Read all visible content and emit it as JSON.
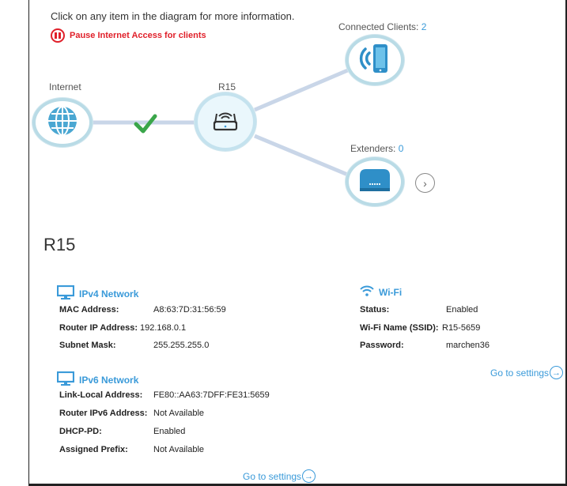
{
  "diagram": {
    "instruction": "Click on any item in the diagram for more information.",
    "pause_label": "Pause Internet Access for clients",
    "internet_label": "Internet",
    "router_label": "R15",
    "clients_label": "Connected Clients:",
    "clients_count": "2",
    "extenders_label": "Extenders:",
    "extenders_count": "0"
  },
  "device": {
    "title": "R15"
  },
  "ipv4": {
    "heading": "IPv4 Network",
    "rows": [
      {
        "key": "MAC Address:",
        "value": "A8:63:7D:31:56:59"
      },
      {
        "key": "Router IP Address:",
        "value": "192.168.0.1"
      },
      {
        "key": "Subnet Mask:",
        "value": "255.255.255.0"
      }
    ]
  },
  "wifi": {
    "heading": "Wi-Fi",
    "rows": [
      {
        "key": "Status:",
        "value": "Enabled"
      },
      {
        "key": "Wi-Fi Name (SSID):",
        "value": "R15-5659"
      },
      {
        "key": "Password:",
        "value": "marchen36"
      }
    ],
    "goto_label": "Go to settings"
  },
  "ipv6": {
    "heading": "IPv6 Network",
    "rows": [
      {
        "key": "Link-Local Address:",
        "value": "FE80::AA63:7DFF:FE31:5659"
      },
      {
        "key": "Router IPv6 Address:",
        "value": "Not Available"
      },
      {
        "key": "DHCP-PD:",
        "value": "Enabled"
      },
      {
        "key": "Assigned Prefix:",
        "value": "Not Available"
      }
    ],
    "goto_label": "Go to settings"
  },
  "colors": {
    "accent": "#3a9ad9",
    "warning": "#e0202a",
    "node_ring": "#b9dbe6",
    "check": "#3aa64a"
  },
  "icons": [
    "pause-icon",
    "globe-icon",
    "router-icon",
    "wifi-phone-icon",
    "extender-icon",
    "check-icon",
    "chevron-right-icon",
    "monitor-icon",
    "wifi-icon",
    "arrow-right-icon"
  ]
}
